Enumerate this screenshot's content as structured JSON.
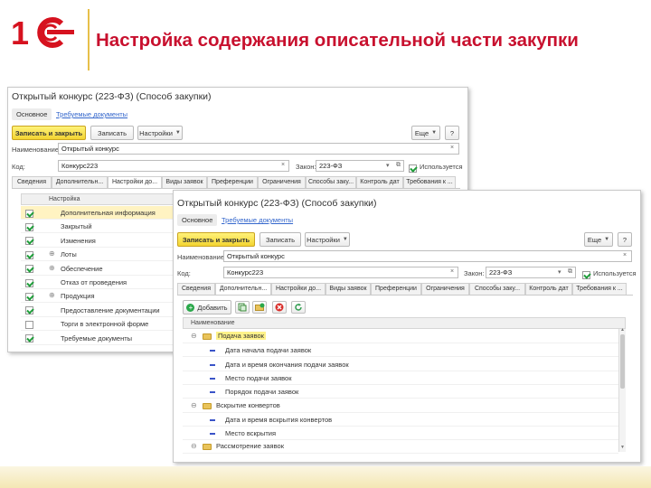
{
  "slide": {
    "title": "Настройка содержания описательной части закупки"
  },
  "window_back": {
    "title": "Открытый конкурс (223-ФЗ) (Способ закупки)",
    "nav": {
      "main": "Основное",
      "required_docs": "Требуемые документы"
    },
    "toolbar": {
      "save_close": "Записать и закрыть",
      "save": "Записать",
      "settings": "Настройки",
      "more": "Еще",
      "help": "?"
    },
    "form": {
      "name_label": "Наименование:",
      "name_value": "Открытый конкурс",
      "code_label": "Код:",
      "code_value": "Конкурс223",
      "law_label": "Закон:",
      "law_value": "223-ФЗ",
      "used_label": "Используется"
    },
    "tabs": [
      "Сведения",
      "Дополнительн...",
      "Настройки до...",
      "Виды заявок",
      "Преференции",
      "Ограничения",
      "Способы заку...",
      "Контроль дат",
      "Требования к ..."
    ],
    "column_header": "Настройка",
    "rows": [
      {
        "label": "Дополнительная информация",
        "checked": true,
        "expand": false
      },
      {
        "label": "Закрытый",
        "checked": true,
        "expand": false
      },
      {
        "label": "Изменения",
        "checked": true,
        "expand": false
      },
      {
        "label": "Лоты",
        "checked": true,
        "expand": true
      },
      {
        "label": "Обеспечение",
        "checked": true,
        "expand": true
      },
      {
        "label": "Отказ от проведения",
        "checked": true,
        "expand": false
      },
      {
        "label": "Продукция",
        "checked": true,
        "expand": true
      },
      {
        "label": "Предоставление документации",
        "checked": true,
        "expand": false
      },
      {
        "label": "Торги в электронной форме",
        "checked": false,
        "expand": false
      },
      {
        "label": "Требуемые документы",
        "checked": true,
        "expand": false
      }
    ]
  },
  "window_front": {
    "title": "Открытый конкурс (223-ФЗ) (Способ закупки)",
    "nav": {
      "main": "Основное",
      "required_docs": "Требуемые документы"
    },
    "toolbar": {
      "save_close": "Записать и закрыть",
      "save": "Записать",
      "settings": "Настройки",
      "more": "Еще",
      "help": "?"
    },
    "form": {
      "name_label": "Наименование:",
      "name_value": "Открытый конкурс",
      "code_label": "Код:",
      "code_value": "Конкурс223",
      "law_label": "Закон:",
      "law_value": "223-ФЗ",
      "used_label": "Используется"
    },
    "tabs": [
      "Сведения",
      "Дополнительн...",
      "Настройки до...",
      "Виды заявок",
      "Преференции",
      "Ограничения",
      "Способы заку...",
      "Контроль дат",
      "Требования к ..."
    ],
    "add_label": "Добавить",
    "column_header": "Наименование",
    "tree": [
      {
        "label": "Подача заявок",
        "type": "group",
        "highlight": true
      },
      {
        "label": "Дата начала подачи заявок",
        "type": "item"
      },
      {
        "label": "Дата и время окончания подачи заявок",
        "type": "item"
      },
      {
        "label": "Место подачи заявок",
        "type": "item"
      },
      {
        "label": "Порядок подачи заявок",
        "type": "item"
      },
      {
        "label": "Вскрытие конвертов",
        "type": "group",
        "highlight": false
      },
      {
        "label": "Дата и время вскрытия конвертов",
        "type": "item"
      },
      {
        "label": "Место вскрытия",
        "type": "item"
      },
      {
        "label": "Рассмотрение заявок",
        "type": "group",
        "highlight": false
      }
    ]
  }
}
